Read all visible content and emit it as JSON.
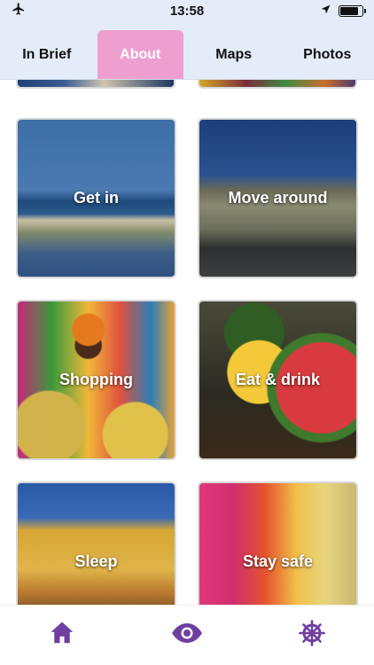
{
  "status_bar": {
    "time": "13:58",
    "airplane_icon": "airplane-icon",
    "location_icon": "location-arrow-icon",
    "battery_level": 0.85
  },
  "tabs": [
    {
      "label": "In Brief",
      "active": false
    },
    {
      "label": "About",
      "active": true
    },
    {
      "label": "Maps",
      "active": false
    },
    {
      "label": "Photos",
      "active": false
    }
  ],
  "cards": [
    {
      "label": "Get in"
    },
    {
      "label": "Move around"
    },
    {
      "label": "Shopping"
    },
    {
      "label": "Eat & drink"
    },
    {
      "label": "Sleep"
    },
    {
      "label": "Stay safe"
    }
  ],
  "bottom_nav": [
    {
      "icon": "home-icon"
    },
    {
      "icon": "eye-icon"
    },
    {
      "icon": "ship-wheel-icon"
    }
  ],
  "colors": {
    "accent": "#ee9fcf",
    "nav_icon": "#6f3fa0",
    "header_bg": "#e3ecf8"
  }
}
